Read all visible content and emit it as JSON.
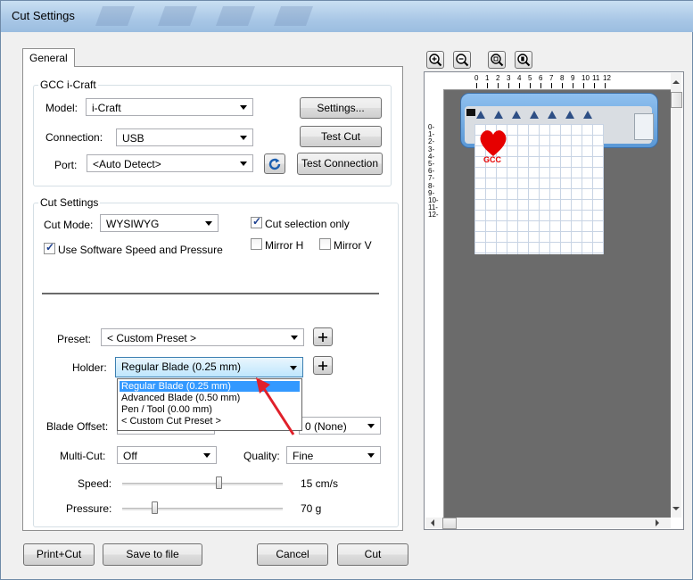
{
  "window": {
    "title": "Cut Settings"
  },
  "tabs": [
    {
      "label": "General"
    }
  ],
  "gcc_group": {
    "title": "GCC i-Craft",
    "model_label": "Model:",
    "model_value": "i-Craft",
    "connection_label": "Connection:",
    "connection_value": "USB",
    "port_label": "Port:",
    "port_value": "<Auto Detect>",
    "settings_button": "Settings...",
    "test_cut_button": "Test Cut",
    "test_connection_button": "Test Connection"
  },
  "cut_group": {
    "title": "Cut Settings",
    "cut_mode_label": "Cut Mode:",
    "cut_mode_value": "WYSIWYG",
    "cut_selection_only": {
      "label": "Cut selection only",
      "checked": true
    },
    "use_software_speed": {
      "label": "Use Software Speed and Pressure",
      "checked": true
    },
    "mirror_h": {
      "label": "Mirror H",
      "checked": false
    },
    "mirror_v": {
      "label": "Mirror V",
      "checked": false
    },
    "preset_label": "Preset:",
    "preset_value": "< Custom Preset >",
    "holder_label": "Holder:",
    "holder_value": "Regular Blade (0.25 mm)",
    "holder_options": [
      "Regular Blade (0.25 mm)",
      "Advanced Blade (0.50 mm)",
      "Pen / Tool (0.00 mm)",
      "< Custom Cut Preset >"
    ],
    "blade_offset_label": "Blade Offset:",
    "overcut_value": "0 (None)",
    "multicut_label": "Multi-Cut:",
    "multicut_value": "Off",
    "quality_label": "Quality:",
    "quality_value": "Fine",
    "speed_label": "Speed:",
    "speed_value": "15 cm/s",
    "speed_level": 0.6,
    "pressure_label": "Pressure:",
    "pressure_value": "70 g",
    "pressure_level": 0.2
  },
  "footer": {
    "print_cut": "Print+Cut",
    "save_to_file": "Save to file",
    "cancel": "Cancel",
    "cut": "Cut"
  },
  "preview": {
    "ruler_top": [
      "0",
      "1",
      "2",
      "3",
      "4",
      "5",
      "6",
      "7",
      "8",
      "9",
      "10",
      "11",
      "12"
    ],
    "ruler_left": [
      "0",
      "1",
      "2",
      "3",
      "4",
      "5",
      "6",
      "7",
      "8",
      "9",
      "10",
      "11",
      "12"
    ],
    "design_text": "GCC"
  },
  "colors": {
    "accent": "#3399ff",
    "heart": "#e60000",
    "machine": "#7fb3e6"
  }
}
